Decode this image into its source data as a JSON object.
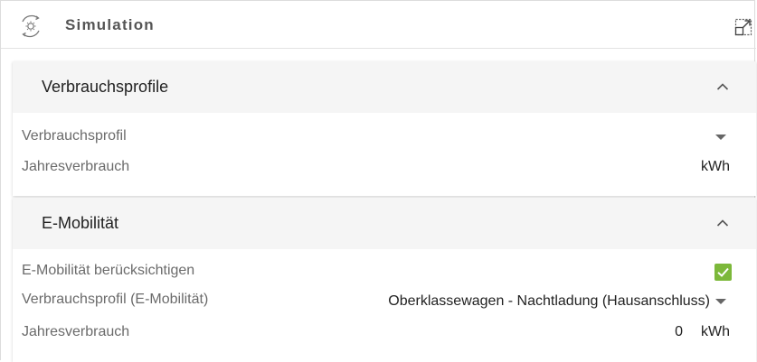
{
  "header": {
    "title": "Simulation",
    "icon": "sun-cycle-icon",
    "expand_icon": "expand-icon"
  },
  "sections": [
    {
      "title": "Verbrauchsprofile",
      "expanded": true,
      "rows": [
        {
          "label": "Verbrauchsprofil",
          "value": ""
        },
        {
          "label": "Jahresverbrauch",
          "value": "",
          "unit": "kWh"
        }
      ]
    },
    {
      "title": "E-Mobilität",
      "expanded": true,
      "rows": [
        {
          "label": "E-Mobilität berücksichtigen",
          "checked": true
        },
        {
          "label": "Verbrauchsprofil (E-Mobilität)",
          "value": "Oberklassewagen - Nachtladung (Hausanschluss)"
        },
        {
          "label": "Jahresverbrauch",
          "value": "0",
          "unit": "kWh"
        }
      ]
    }
  ],
  "colors": {
    "checkbox": "#7cb83a",
    "panel_header_bg": "#f5f5f5",
    "label_text": "#6b6b6b"
  }
}
